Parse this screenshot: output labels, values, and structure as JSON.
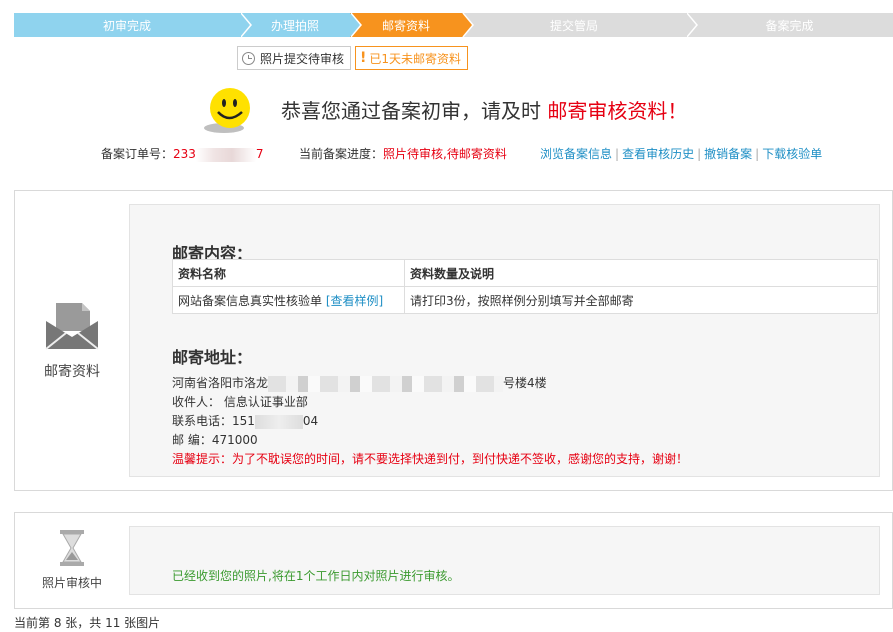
{
  "steps": [
    {
      "label": "初审完成",
      "state": "done"
    },
    {
      "label": "办理拍照",
      "state": "done"
    },
    {
      "label": "邮寄资料",
      "state": "current"
    },
    {
      "label": "提交管局",
      "state": "todo"
    },
    {
      "label": "备案完成",
      "state": "todo"
    }
  ],
  "badges": {
    "photo_status": "照片提交待审核",
    "mail_overdue": "已1天未邮寄资料"
  },
  "headline": {
    "prefix": "恭喜您通过备案初审，请及时 ",
    "highlight": "邮寄审核资料！"
  },
  "order": {
    "label": "备案订单号：",
    "value_start": "233",
    "value_end": "7"
  },
  "progress": {
    "label": "当前备案进度：",
    "value": "照片待审核,待邮寄资料"
  },
  "links": [
    "浏览备案信息",
    "查看审核历史",
    "撤销备案",
    "下载核验单"
  ],
  "mail_panel": {
    "side_label": "邮寄资料",
    "content_title": "邮寄内容：",
    "table_headers": [
      "资料名称",
      "资料数量及说明"
    ],
    "table_rows": [
      {
        "name": "网站备案信息真实性核验单",
        "link": "[查看样例]",
        "desc": "请打印3份，按照样例分别填写并全部邮寄"
      }
    ],
    "address_title": "邮寄地址：",
    "address_start": "河南省洛阳市洛龙",
    "address_end": "号楼4楼",
    "recipient": "收件人： 信息认证事业部",
    "phone_start": "联系电话：151",
    "phone_end": "04",
    "postcode": "邮 编：471000",
    "tip": "温馨提示：为了不耽误您的时间，请不要选择快递到付，到付快递不签收，感谢您的支持，谢谢！"
  },
  "review_panel": {
    "side_label": "照片审核中",
    "message": "已经收到您的照片,将在1个工作日内对照片进行审核。"
  },
  "footer": "当前第 8 张，共 11 张图片",
  "colors": {
    "step_done": "#8fd3ee",
    "step_current": "#f7931e",
    "step_todo": "#dcdcdc",
    "highlight_red": "#e60012",
    "link_blue": "#1f8fc5",
    "success_green": "#3b9a2f"
  }
}
